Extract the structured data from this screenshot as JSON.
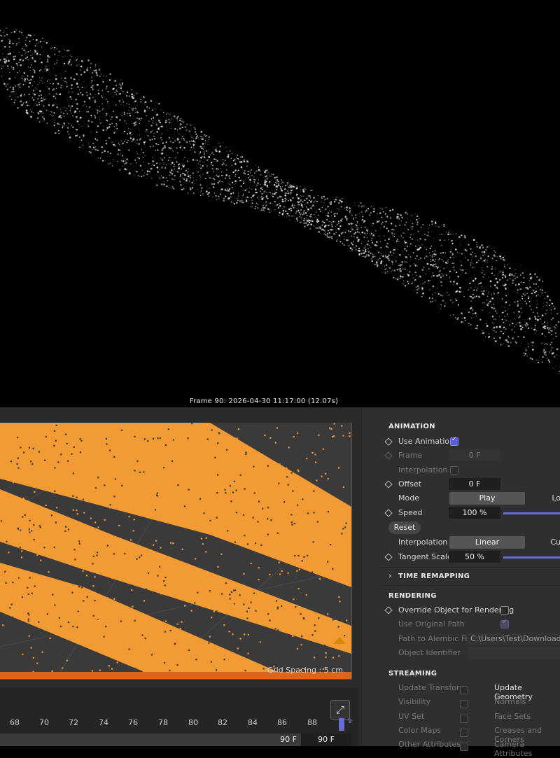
{
  "render_view": {
    "caption": "Frame  90:  2026-04-30  11:17:00  (12.07s)"
  },
  "viewport": {
    "grid_spacing": "Grid Spacing : 5 cm"
  },
  "timeline": {
    "ticks": [
      "68",
      "70",
      "72",
      "74",
      "76",
      "78",
      "80",
      "82",
      "84",
      "86",
      "88"
    ],
    "end_marker": "9",
    "current_frame_left": "90 F",
    "current_frame_right": "90 F"
  },
  "panel": {
    "animation": {
      "title": "ANIMATION",
      "use_animation": "Use Animation",
      "frame_label": "Frame",
      "frame_value": "0 F",
      "interpolation_label": "Interpolation",
      "offset_label": "Offset",
      "offset_value": "0 F",
      "mode_label": "Mode",
      "mode_play": "Play",
      "mode_loop": "Lo",
      "speed_label": "Speed",
      "speed_value": "100 %",
      "reset_label": "Reset",
      "interpolation2_label": "Interpolation",
      "interp_linear": "Linear",
      "interp_cubic": "Cu",
      "tangent_label": "Tangent Scale",
      "tangent_value": "50 %"
    },
    "time_remapping": "TIME REMAPPING",
    "rendering": {
      "title": "RENDERING",
      "override": "Override Object for Rendering",
      "use_original_path": "Use Original Path",
      "path_label": "Path to Alembic File",
      "path_value": "C:\\Users\\Test\\Downloads\\N",
      "object_identifier": "Object Identifier"
    },
    "streaming": {
      "title": "STREAMING",
      "update_transform": "Update Transform",
      "update_geometry": "Update Geometry",
      "visibility": "Visibility",
      "normals": "Normals",
      "uv_set": "UV Set",
      "face_sets": "Face Sets",
      "color_maps": "Color Maps",
      "creases": "Creases and Corners",
      "other_attributes": "Other Attributes",
      "camera_attributes": "Camera Attributes"
    }
  },
  "colors": {
    "particle_white": "#d9d9d9",
    "particle_orange": "#f29a33",
    "accent": "#5a5fd0"
  }
}
